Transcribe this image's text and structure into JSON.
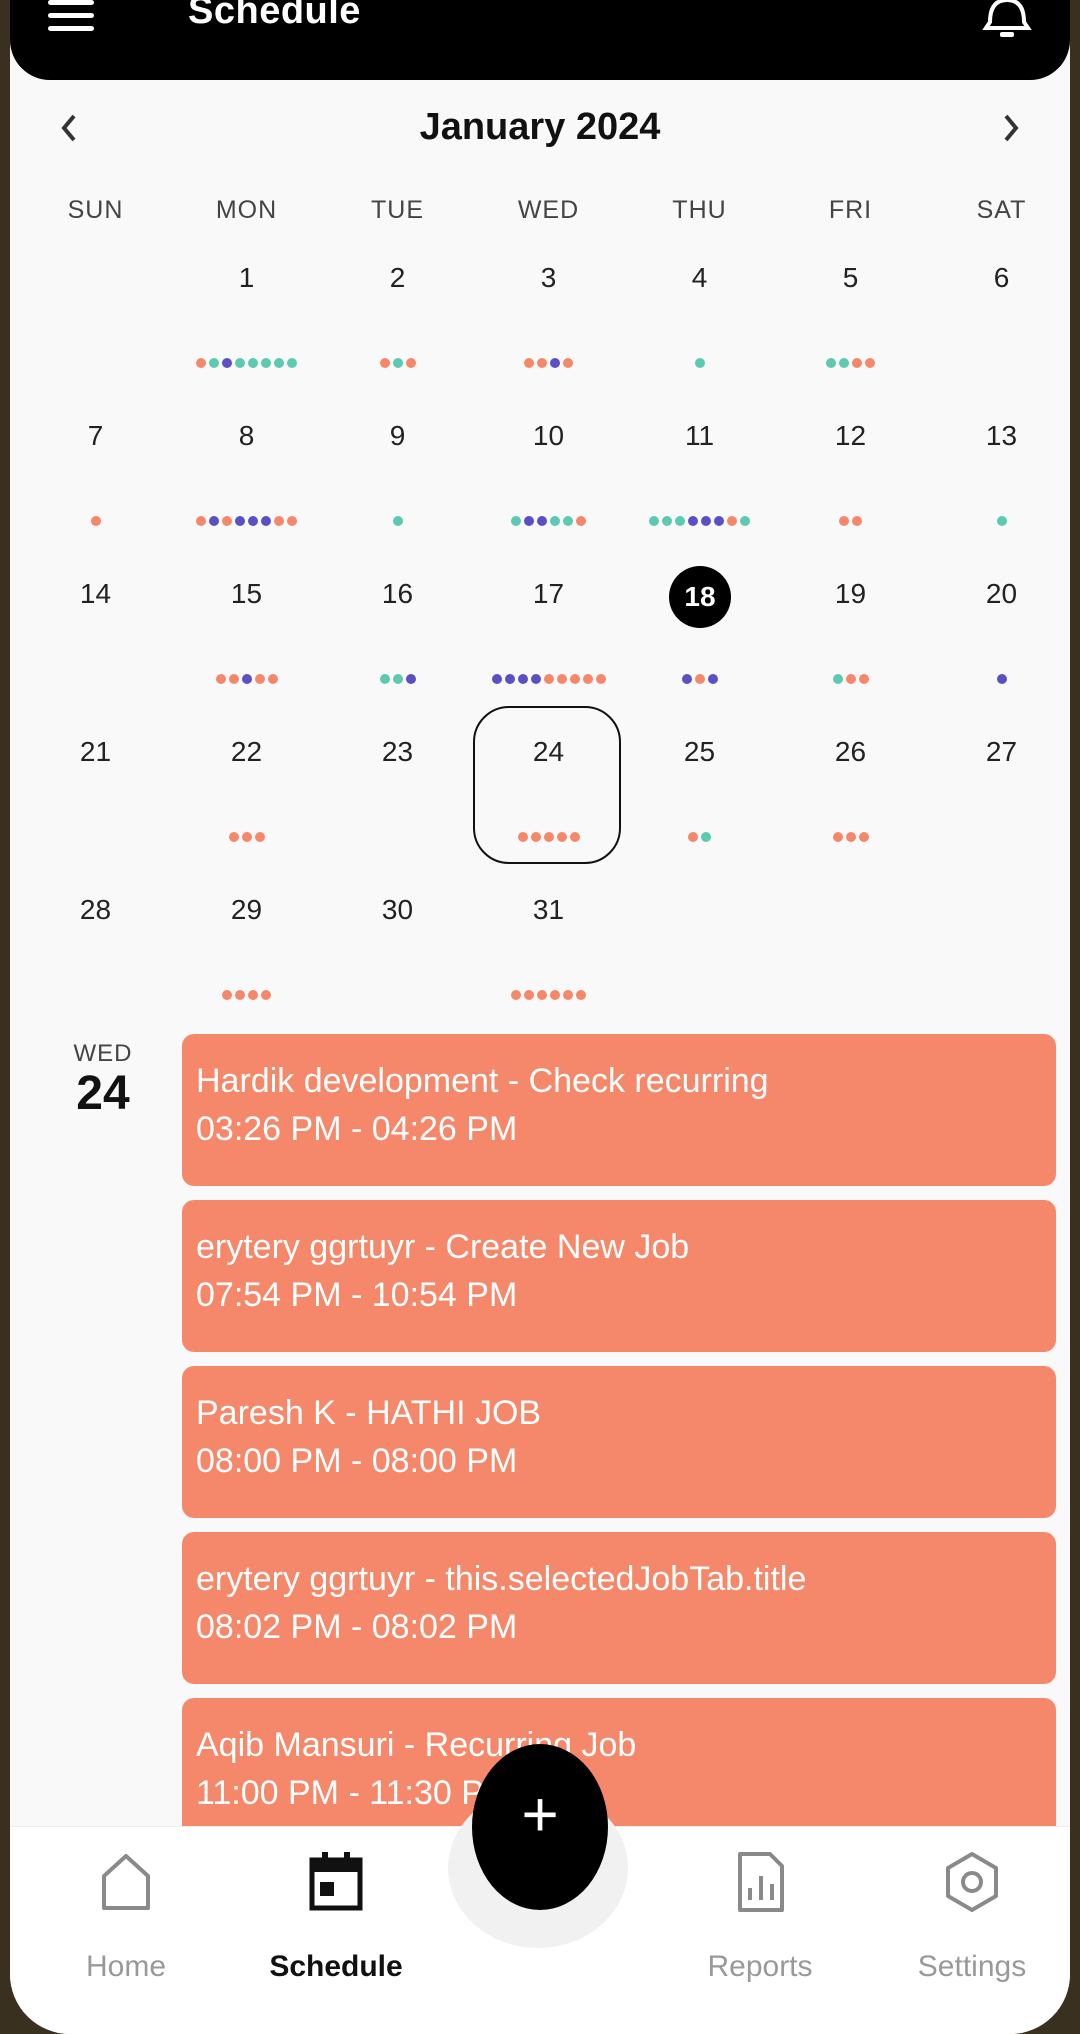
{
  "header": {
    "title": "Schedule",
    "menu_icon": "hamburger-icon",
    "bell_icon": "bell-icon"
  },
  "calendar": {
    "month_label": "January 2024",
    "weekdays": [
      "SUN",
      "MON",
      "TUE",
      "WED",
      "THU",
      "FRI",
      "SAT"
    ],
    "today": 18,
    "selected": 24,
    "colors": {
      "coral": "#f5886a",
      "teal": "#5cc9b0",
      "purple": "#5b4fc4"
    },
    "days": [
      {
        "d": 1,
        "dots": [
          "c",
          "t",
          "p",
          "t",
          "t",
          "t",
          "t",
          "t"
        ]
      },
      {
        "d": 2,
        "dots": [
          "c",
          "t",
          "c"
        ]
      },
      {
        "d": 3,
        "dots": [
          "c",
          "c",
          "p",
          "c"
        ]
      },
      {
        "d": 4,
        "dots": [
          "t"
        ]
      },
      {
        "d": 5,
        "dots": [
          "t",
          "t",
          "c",
          "c"
        ]
      },
      {
        "d": 6,
        "dots": []
      },
      {
        "d": 7,
        "dots": [
          "c"
        ]
      },
      {
        "d": 8,
        "dots": [
          "c",
          "p",
          "c",
          "p",
          "p",
          "p",
          "c",
          "c"
        ]
      },
      {
        "d": 9,
        "dots": [
          "t"
        ]
      },
      {
        "d": 10,
        "dots": [
          "t",
          "p",
          "p",
          "t",
          "t",
          "c"
        ]
      },
      {
        "d": 11,
        "dots": [
          "t",
          "t",
          "t",
          "p",
          "p",
          "p",
          "c",
          "t"
        ]
      },
      {
        "d": 12,
        "dots": [
          "c",
          "c"
        ]
      },
      {
        "d": 13,
        "dots": [
          "t"
        ]
      },
      {
        "d": 14,
        "dots": []
      },
      {
        "d": 15,
        "dots": [
          "c",
          "c",
          "p",
          "c",
          "c"
        ]
      },
      {
        "d": 16,
        "dots": [
          "t",
          "t",
          "p"
        ]
      },
      {
        "d": 17,
        "dots": [
          "p",
          "p",
          "p",
          "p",
          "c",
          "c",
          "c",
          "c",
          "c"
        ]
      },
      {
        "d": 18,
        "dots": [
          "p",
          "c",
          "p"
        ]
      },
      {
        "d": 19,
        "dots": [
          "t",
          "c",
          "c"
        ]
      },
      {
        "d": 20,
        "dots": [
          "p"
        ]
      },
      {
        "d": 21,
        "dots": []
      },
      {
        "d": 22,
        "dots": [
          "c",
          "c",
          "c"
        ]
      },
      {
        "d": 23,
        "dots": []
      },
      {
        "d": 24,
        "dots": [
          "c",
          "c",
          "c",
          "c",
          "c"
        ]
      },
      {
        "d": 25,
        "dots": [
          "c",
          "t"
        ]
      },
      {
        "d": 26,
        "dots": [
          "c",
          "c",
          "c"
        ]
      },
      {
        "d": 27,
        "dots": []
      },
      {
        "d": 28,
        "dots": []
      },
      {
        "d": 29,
        "dots": [
          "c",
          "c",
          "c",
          "c"
        ]
      },
      {
        "d": 30,
        "dots": []
      },
      {
        "d": 31,
        "dots": [
          "c",
          "c",
          "c",
          "c",
          "c",
          "c"
        ]
      }
    ]
  },
  "selected_day": {
    "dow": "WED",
    "num": "24"
  },
  "events": [
    {
      "title": "Hardik development - Check recurring",
      "time": "03:26 PM - 04:26 PM"
    },
    {
      "title": "erytery ggrtuyr - Create New Job",
      "time": "07:54 PM - 10:54 PM"
    },
    {
      "title": "Paresh K - HATHI JOB",
      "time": "08:00 PM - 08:00 PM"
    },
    {
      "title": "erytery ggrtuyr - this.selectedJobTab.title",
      "time": "08:02 PM - 08:02 PM"
    },
    {
      "title": "Aqib Mansuri - Recurring Job",
      "time": "11:00 PM - 11:30 PM"
    }
  ],
  "fab": {
    "label": "+",
    "icon": "plus-icon"
  },
  "tabs": [
    {
      "label": "Home",
      "icon": "home-icon"
    },
    {
      "label": "Schedule",
      "icon": "calendar-icon"
    },
    {
      "label": "Reports",
      "icon": "reports-icon"
    },
    {
      "label": "Settings",
      "icon": "settings-icon"
    }
  ]
}
